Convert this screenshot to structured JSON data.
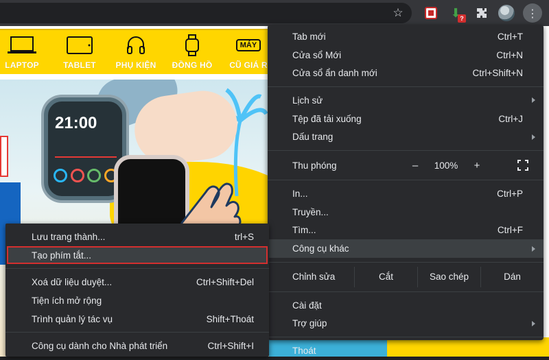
{
  "toolbar": {
    "star_icon": "star-icon",
    "mcafee_icon": "mcafee-extension-icon",
    "download_badge": "?",
    "extensions_icon": "puzzle-icon",
    "avatar": "profile-avatar",
    "menu_icon": "kebab-menu-icon"
  },
  "site": {
    "nav": [
      "LAPTOP",
      "TABLET",
      "PHỤ KIỆN",
      "ĐỒNG HỒ",
      "CŨ GIÁ R"
    ],
    "nav_top_right_badge": "MÁY",
    "watch_time": "21:00"
  },
  "menu": {
    "new_tab": {
      "label": "Tab mới",
      "shortcut": "Ctrl+T"
    },
    "new_window": {
      "label": "Cửa sổ Mới",
      "shortcut": "Ctrl+N"
    },
    "incognito": {
      "label": "Cửa sổ ẩn danh mới",
      "shortcut": "Ctrl+Shift+N"
    },
    "history": {
      "label": "Lịch sử"
    },
    "downloads": {
      "label": "Tệp đã tải xuống",
      "shortcut": "Ctrl+J"
    },
    "bookmarks": {
      "label": "Dấu trang"
    },
    "zoom": {
      "label": "Thu phóng",
      "minus": "–",
      "value": "100%",
      "plus": "+"
    },
    "print": {
      "label": "In...",
      "shortcut": "Ctrl+P"
    },
    "cast": {
      "label": "Truyền..."
    },
    "find": {
      "label": "Tìm...",
      "shortcut": "Ctrl+F"
    },
    "more_tools": {
      "label": "Công cụ khác"
    },
    "edit": {
      "label": "Chỉnh sửa",
      "cut": "Cắt",
      "copy": "Sao chép",
      "paste": "Dán"
    },
    "settings": {
      "label": "Cài đặt"
    },
    "help": {
      "label": "Trợ giúp"
    },
    "exit": {
      "label": "Thoát"
    }
  },
  "submenu": {
    "save_page": {
      "label": "Lưu trang thành...",
      "shortcut": "Ctrl+S",
      "shortcut_visible": "trl+S"
    },
    "create_shortcut": {
      "label": "Tạo phím tắt..."
    },
    "clear_data": {
      "label": "Xoá dữ liệu duyệt...",
      "shortcut": "Ctrl+Shift+Del"
    },
    "extensions": {
      "label": "Tiện ích mở rộng"
    },
    "task_manager": {
      "label": "Trình quản lý tác vụ",
      "shortcut": "Shift+Thoát"
    },
    "devtools": {
      "label": "Công cụ dành cho Nhà phát triển",
      "shortcut": "Ctrl+Shift+I"
    }
  }
}
